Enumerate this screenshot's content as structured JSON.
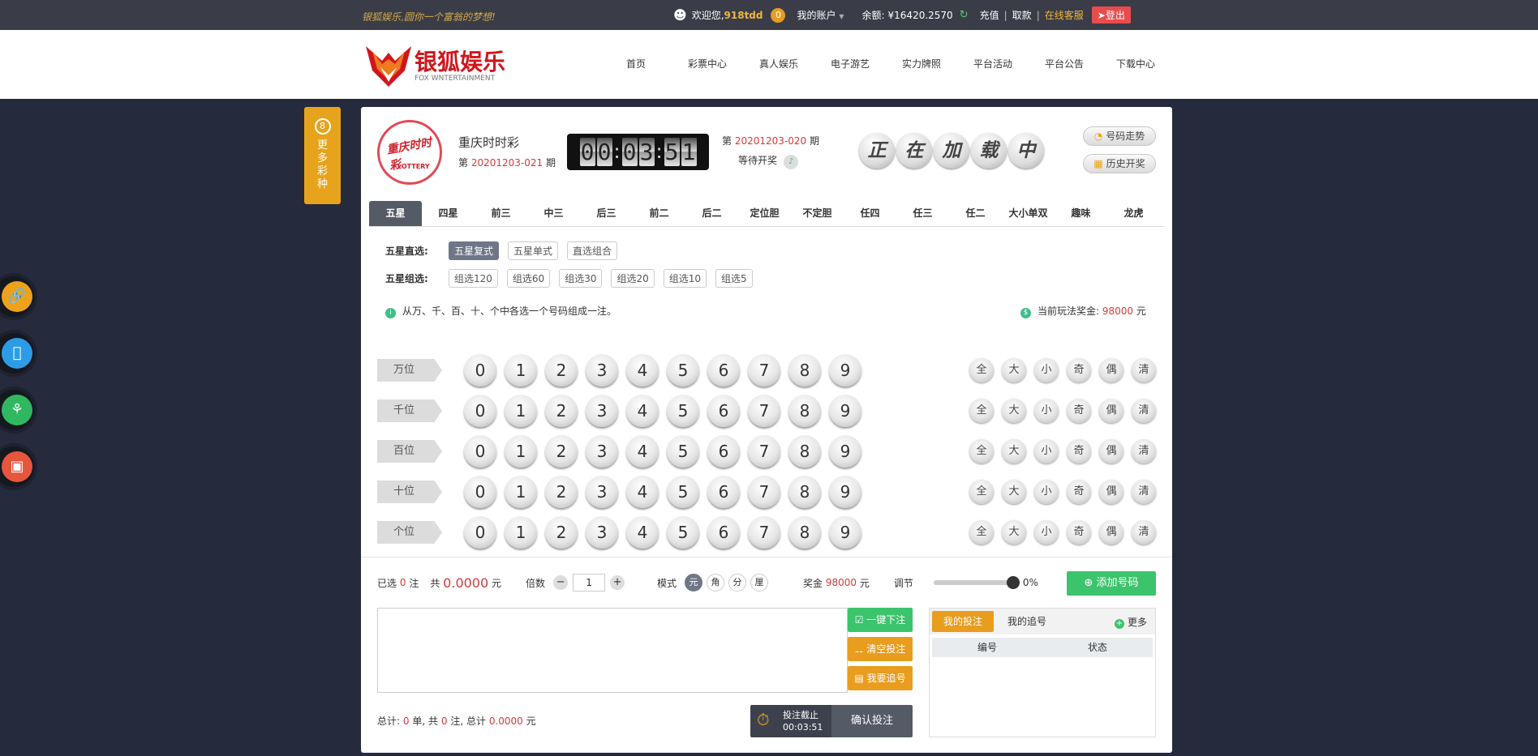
{
  "topbar": {
    "slogan": "银狐娱乐,圆你一个富翁的梦想!",
    "welcome": "欢迎您,",
    "username": "918tdd",
    "coin_count": "0",
    "my_account": "我的账户",
    "balance_label": "余额:",
    "balance_value": "¥16420.2570",
    "recharge": "充值",
    "withdraw": "取款",
    "service": "在线客服",
    "logout": "登出",
    "sep": "|"
  },
  "brand": {
    "name": "银狐娱乐",
    "sub": "FOX WNTERTAINMENT",
    "accent": "#d0161c"
  },
  "nav": [
    "首页",
    "彩票中心",
    "真人娱乐",
    "电子游艺",
    "实力牌照",
    "平台活动",
    "平台公告",
    "下载中心"
  ],
  "side_tab": {
    "icon": "8",
    "label": "更多彩种"
  },
  "float_icons": [
    "link-icon",
    "apple-icon",
    "android-icon",
    "desktop-icon"
  ],
  "lottery": {
    "badge_main": "重庆时时彩",
    "badge_sub": "LOTTERY",
    "name": "重庆时时彩",
    "issue_prefix": "第",
    "issue": "20201203-021",
    "issue_suffix": "期",
    "countdown": [
      "0",
      "0",
      ":",
      "0",
      "3",
      ":",
      "5",
      "1"
    ],
    "next_prefix": "第",
    "next_issue": "20201203-020",
    "next_suffix": "期",
    "waiting": "等待开奖",
    "loading_chars": [
      "正",
      "在",
      "加",
      "载",
      "中"
    ],
    "trend": "号码走势",
    "history": "历史开奖"
  },
  "tabs": [
    "五星",
    "四星",
    "前三",
    "中三",
    "后三",
    "前二",
    "后二",
    "定位胆",
    "不定胆",
    "任四",
    "任三",
    "任二",
    "大小单双",
    "趣味",
    "龙虎"
  ],
  "sub_direct": {
    "label": "五星直选:",
    "options": [
      "五星复式",
      "五星单式",
      "直选组合"
    ]
  },
  "sub_group": {
    "label": "五星组选:",
    "options": [
      "组选120",
      "组选60",
      "组选30",
      "组选20",
      "组选10",
      "组选5"
    ]
  },
  "hint": "从万、千、百、十、个中各选一个号码组成一注。",
  "prize": {
    "label": "当前玩法奖金:",
    "value": "98000",
    "unit": "元"
  },
  "positions": [
    "万位",
    "千位",
    "百位",
    "十位",
    "个位"
  ],
  "digits": [
    "0",
    "1",
    "2",
    "3",
    "4",
    "5",
    "6",
    "7",
    "8",
    "9"
  ],
  "quick": [
    "全",
    "大",
    "小",
    "奇",
    "偶",
    "清"
  ],
  "selection": {
    "selected_label": "已选",
    "selected_count": "0",
    "bet_unit": "注",
    "total_label": "共",
    "total_amount": "0.0000",
    "currency": "元",
    "multiple_label": "倍数",
    "minus": "−",
    "multiple_value": "1",
    "plus": "+",
    "mode_label": "模式",
    "modes": [
      "元",
      "角",
      "分",
      "厘"
    ],
    "bonus_label": "奖金",
    "bonus_value": "98000",
    "bonus_unit": "元",
    "adjust_label": "调节",
    "adjust_value": "0%",
    "add_button": "添加号码"
  },
  "actions": {
    "one_click": "一键下注",
    "clear": "清空投注",
    "chase": "我要追号"
  },
  "totals": {
    "label": "总计:",
    "orders": "0",
    "orders_unit": "单,",
    "total": "共",
    "bets": "0",
    "bets_unit": "注,",
    "sum_label": "总计",
    "sum": "0.0000",
    "unit": "元"
  },
  "confirm": {
    "deadline_label": "投注截止",
    "deadline": "00:03:51",
    "button": "确认投注"
  },
  "mybets": {
    "tab1": "我的投注",
    "tab2": "我的追号",
    "more": "更多",
    "col_id": "编号",
    "col_status": "状态"
  }
}
